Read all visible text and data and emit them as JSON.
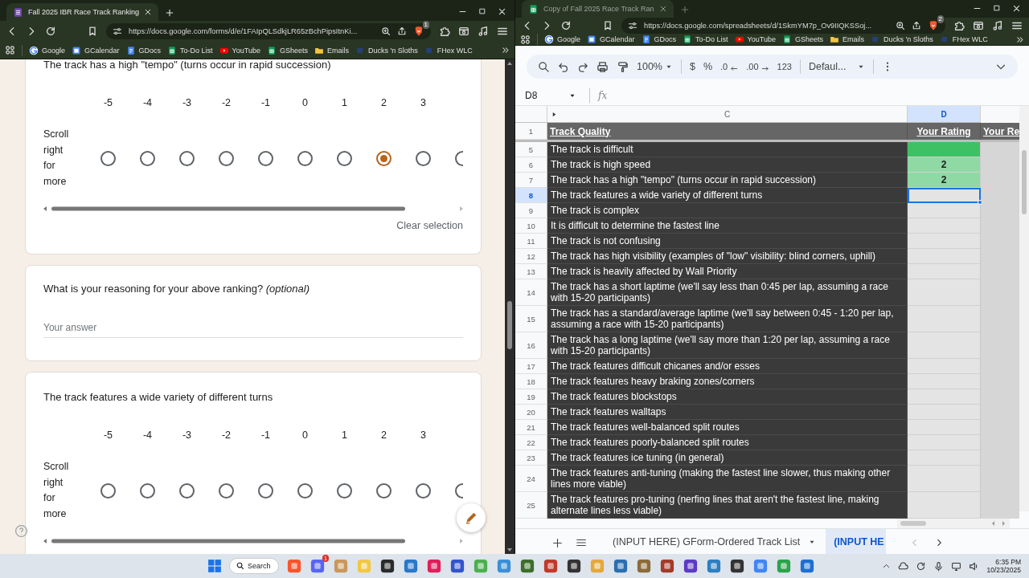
{
  "windows": [
    {
      "active": true,
      "tab_title": "Fall 2025 IBR Race Track Ranking",
      "url": "https://docs.google.com/forms/d/e/1FAIpQLSdkjLR65zBchPipsItnKi...",
      "shields_badge": "1",
      "bookmarks": [
        {
          "kind": "google",
          "label": "Google"
        },
        {
          "kind": "calendar",
          "label": "GCalendar"
        },
        {
          "kind": "docs",
          "label": "GDocs"
        },
        {
          "kind": "sheets",
          "label": "To-Do List"
        },
        {
          "kind": "youtube",
          "label": "YouTube"
        },
        {
          "kind": "sheets",
          "label": "GSheets"
        },
        {
          "kind": "folder",
          "label": "Emails"
        },
        {
          "kind": "site",
          "label": "Ducks 'n Sloths"
        },
        {
          "kind": "site",
          "label": "FHex WLC"
        }
      ]
    },
    {
      "active": false,
      "tab_title": "Copy of Fall 2025 Race Track Ran",
      "url": "https://docs.google.com/spreadsheets/d/1SkmYM7p_Ov9IIQKSSoj...",
      "shields_badge": "2",
      "bookmarks": [
        {
          "kind": "google",
          "label": "Google"
        },
        {
          "kind": "calendar",
          "label": "GCalendar"
        },
        {
          "kind": "docs",
          "label": "GDocs"
        },
        {
          "kind": "sheets",
          "label": "To-Do List"
        },
        {
          "kind": "youtube",
          "label": "YouTube"
        },
        {
          "kind": "sheets",
          "label": "GSheets"
        },
        {
          "kind": "folder",
          "label": "Emails"
        },
        {
          "kind": "site",
          "label": "Ducks 'n Sloths"
        },
        {
          "kind": "site",
          "label": "FHex WLC"
        }
      ]
    }
  ],
  "form": {
    "cards": [
      {
        "kind": "scale",
        "title": "The track has a high \"tempo\" (turns occur in rapid succession)",
        "scale": [
          "-5",
          "-4",
          "-3",
          "-2",
          "-1",
          "0",
          "1",
          "2",
          "3"
        ],
        "row_label": "Scroll right for more",
        "options": [
          {
            "selected": false
          },
          {
            "selected": false
          },
          {
            "selected": false
          },
          {
            "selected": false
          },
          {
            "selected": false
          },
          {
            "selected": false
          },
          {
            "selected": false
          },
          {
            "selected": true
          },
          {
            "selected": false
          },
          {
            "selected": false
          }
        ],
        "clear": "Clear selection"
      },
      {
        "kind": "text",
        "title": "What is your reasoning for your above ranking? *(optional)*",
        "placeholder": "Your answer"
      },
      {
        "kind": "scale",
        "title": "The track features a wide variety of different turns",
        "scale": [
          "-5",
          "-4",
          "-3",
          "-2",
          "-1",
          "0",
          "1",
          "2",
          "3"
        ],
        "row_label": "Scroll right for more",
        "options": [
          {
            "selected": false
          },
          {
            "selected": false
          },
          {
            "selected": false
          },
          {
            "selected": false
          },
          {
            "selected": false
          },
          {
            "selected": false
          },
          {
            "selected": false
          },
          {
            "selected": false
          },
          {
            "selected": false
          },
          {
            "selected": false
          }
        ]
      }
    ]
  },
  "sheet": {
    "toolbar": {
      "zoom": "100%",
      "currency": "$",
      "percent": "%",
      "decrease_decimals": ".0",
      "increase_decimals": ".00",
      "number_format": "123",
      "font": "Defaul..."
    },
    "name_box": "D8",
    "formula_label": "fx",
    "columns": [
      {
        "label": "C",
        "selected": false
      },
      {
        "label": "D",
        "selected": true
      }
    ],
    "header_row": {
      "number": "1",
      "cells": [
        "Track Quality",
        "Your Rating",
        "Your Re"
      ]
    },
    "rows": [
      {
        "number": "5",
        "text": "The track is difficult",
        "color": "#3ec164",
        "selected": false
      },
      {
        "number": "6",
        "text": "The track is high speed",
        "rating": "2",
        "color": "#8fd9a5",
        "selected": false
      },
      {
        "number": "7",
        "text": "The track has a high \"tempo\" (turns occur in rapid succession)",
        "rating": "2",
        "color": "#8fd9a5",
        "selected": false
      },
      {
        "number": "8",
        "text": "The track features a wide variety of different turns",
        "selected": true
      },
      {
        "number": "9",
        "text": "The track is complex",
        "selected": false
      },
      {
        "number": "10",
        "text": "It is difficult to determine the fastest line",
        "selected": false
      },
      {
        "number": "11",
        "text": "The track is not confusing",
        "selected": false
      },
      {
        "number": "12",
        "text": "The track has high visibility (examples of \"low\" visibility: blind corners, uphill)",
        "selected": false
      },
      {
        "number": "13",
        "text": "The track is heavily affected by Wall Priority",
        "selected": false
      },
      {
        "number": "14",
        "text": "The track has a short laptime (we'll say less than 0:45 per lap, assuming a race with 15-20 participants)",
        "selected": false
      },
      {
        "number": "15",
        "text": "The track has a standard/average laptime (we'll say between 0:45 - 1:20 per lap, assuming a race with 15-20 participants)",
        "selected": false
      },
      {
        "number": "16",
        "text": "The track has a long laptime (we'll say more than 1:20 per lap, assuming a race with 15-20 participants)",
        "selected": false
      },
      {
        "number": "17",
        "text": "The track features difficult chicanes and/or esses",
        "selected": false
      },
      {
        "number": "18",
        "text": "The track features heavy braking zones/corners",
        "selected": false
      },
      {
        "number": "19",
        "text": "The track features blockstops",
        "selected": false
      },
      {
        "number": "20",
        "text": "The track features walltaps",
        "selected": false
      },
      {
        "number": "21",
        "text": "The track features well-balanced split routes",
        "selected": false
      },
      {
        "number": "22",
        "text": "The track features poorly-balanced split routes",
        "selected": false
      },
      {
        "number": "23",
        "text": "The track features ice tuning (in general)",
        "selected": false
      },
      {
        "number": "24",
        "text": "The track features anti-tuning (making the fastest line slower, thus making other lines more viable)",
        "selected": false
      },
      {
        "number": "25",
        "text": "The track features pro-tuning (nerfing lines that aren't the fastest line, making alternate lines less viable)",
        "selected": false
      }
    ],
    "sheet_tabs": [
      {
        "label": "(INPUT HERE) GForm-Ordered Track List",
        "selected": false
      },
      {
        "label": "(INPUT HE",
        "selected": true
      }
    ]
  },
  "taskbar": {
    "search": "Search",
    "badge": "1",
    "time": "6:35 PM",
    "date": "10/23/2025"
  }
}
